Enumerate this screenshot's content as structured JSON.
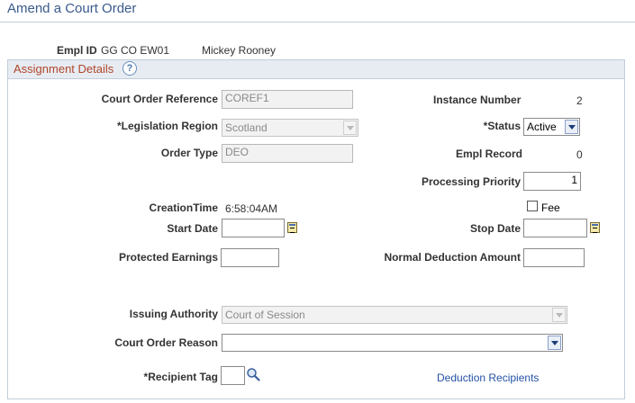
{
  "page": {
    "title": "Amend a Court Order"
  },
  "employee": {
    "empl_id_label": "Empl ID",
    "empl_id": "GG CO EW01",
    "name": "Mickey Rooney"
  },
  "assignment": {
    "section_title": "Assignment Details",
    "help_glyph": "?",
    "court_order_reference": {
      "label": "Court Order Reference",
      "value": "COREF1"
    },
    "instance_number": {
      "label": "Instance Number",
      "value": "2"
    },
    "legislation_region": {
      "label": "*Legislation Region",
      "value": "Scotland"
    },
    "status": {
      "label": "*Status",
      "value": "Active"
    },
    "order_type": {
      "label": "Order Type",
      "value": "DEO"
    },
    "empl_record": {
      "label": "Empl Record",
      "value": "0"
    },
    "processing_priority": {
      "label": "Processing Priority",
      "value": "1"
    },
    "creation_time": {
      "label": "CreationTime",
      "value": "6:58:04AM"
    },
    "fee": {
      "label": "Fee",
      "checked": false
    },
    "start_date": {
      "label": "Start Date",
      "value": ""
    },
    "stop_date": {
      "label": "Stop Date",
      "value": ""
    },
    "protected_earnings": {
      "label": "Protected Earnings",
      "value": ""
    },
    "normal_deduction_amount": {
      "label": "Normal Deduction Amount",
      "value": ""
    },
    "issuing_authority": {
      "label": "Issuing Authority",
      "value": "Court of Session"
    },
    "court_order_reason": {
      "label": "Court Order Reason",
      "value": ""
    },
    "recipient_tag": {
      "label": "*Recipient Tag",
      "value": ""
    },
    "deduction_recipients_link": "Deduction Recipients"
  }
}
